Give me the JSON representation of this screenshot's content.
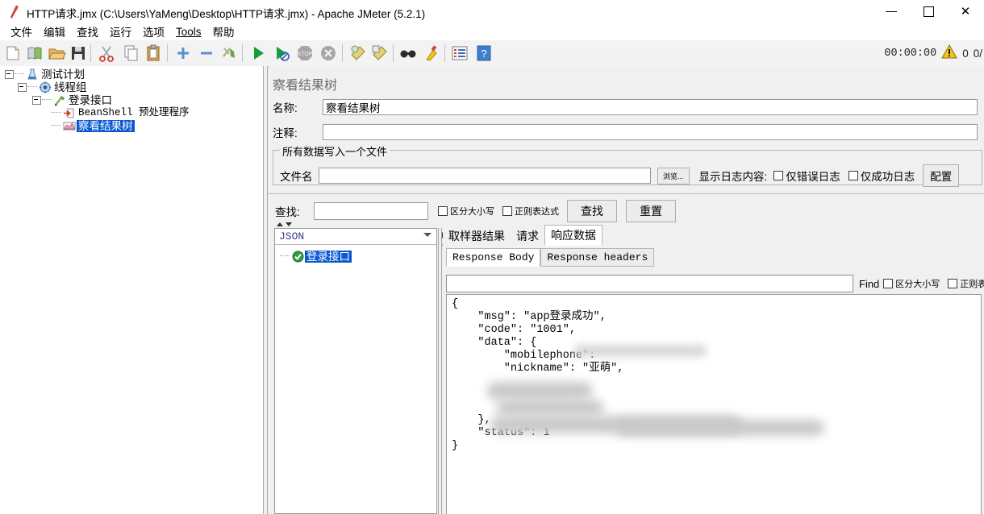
{
  "window": {
    "title": "HTTP请求.jmx (C:\\Users\\YaMeng\\Desktop\\HTTP请求.jmx) - Apache JMeter (5.2.1)",
    "app_icon": "jmeter-feather-icon",
    "minimize": "—",
    "maximize": "☐",
    "close": "✕"
  },
  "menubar": {
    "items": [
      {
        "label": "文件",
        "name": "menu-file"
      },
      {
        "label": "编辑",
        "name": "menu-edit"
      },
      {
        "label": "查找",
        "name": "menu-search"
      },
      {
        "label": "运行",
        "name": "menu-run"
      },
      {
        "label": "选项",
        "name": "menu-options"
      },
      {
        "label": "Tools",
        "name": "menu-tools"
      },
      {
        "label": "帮助",
        "name": "menu-help"
      }
    ]
  },
  "toolbar": {
    "buttons": [
      {
        "name": "new-icon",
        "title": "新建"
      },
      {
        "name": "templates-icon",
        "title": "模板"
      },
      {
        "name": "open-icon",
        "title": "打开"
      },
      {
        "name": "save-icon",
        "title": "保存"
      },
      {
        "name": "cut-icon",
        "title": "剪切"
      },
      {
        "name": "copy-icon",
        "title": "复制"
      },
      {
        "name": "paste-icon",
        "title": "粘贴"
      },
      {
        "name": "expand-icon",
        "title": "展开"
      },
      {
        "name": "collapse-icon",
        "title": "收起"
      },
      {
        "name": "toggle-icon",
        "title": "切换"
      },
      {
        "name": "start-icon",
        "title": "启动"
      },
      {
        "name": "start-no-pause-icon",
        "title": "无间隔启动"
      },
      {
        "name": "stop-icon",
        "title": "停止"
      },
      {
        "name": "shutdown-icon",
        "title": "关闭"
      },
      {
        "name": "clear-icon",
        "title": "清除"
      },
      {
        "name": "clear-all-icon",
        "title": "清除全部"
      },
      {
        "name": "search-icon",
        "title": "搜索"
      },
      {
        "name": "reset-search-icon",
        "title": "重置搜索"
      },
      {
        "name": "function-helper-icon",
        "title": "函数助手"
      },
      {
        "name": "help-icon",
        "title": "帮助"
      }
    ],
    "clock": "00:00:00",
    "warning_icon": "warning-triangle-icon",
    "warning_count": "0",
    "thread_count": "0/"
  },
  "tree": {
    "nodes": [
      {
        "label": "测试计划",
        "icon": "test-plan-icon",
        "depth": 0,
        "selected": false,
        "mono": false
      },
      {
        "label": "线程组",
        "icon": "thread-group-icon",
        "depth": 1,
        "selected": false,
        "mono": false
      },
      {
        "label": "登录接口",
        "icon": "http-sampler-icon",
        "depth": 2,
        "selected": false,
        "mono": false
      },
      {
        "label": "BeanShell 预处理程序",
        "icon": "preprocessor-icon",
        "depth": 3,
        "selected": false,
        "mono": true
      },
      {
        "label": "察看结果树",
        "icon": "view-results-tree-icon",
        "depth": 3,
        "selected": true,
        "mono": false
      }
    ]
  },
  "panel": {
    "title": "察看结果树",
    "name_label": "名称:",
    "name_value": "察看结果树",
    "comment_label": "注释:",
    "comment_value": "",
    "filegroup": {
      "title": "所有数据写入一个文件",
      "filename_label": "文件名",
      "filename_value": "",
      "browse_button": "浏览...",
      "log_display_label": "显示日志内容:",
      "errors_only_label": "仅错误日志",
      "success_only_label": "仅成功日志",
      "config_button": "配置"
    },
    "search": {
      "label": "查找:",
      "value": "",
      "case_sensitive_label": "区分大小写",
      "regex_label": "正则表达式",
      "find_button": "查找",
      "reset_button": "重置"
    }
  },
  "results": {
    "renderer": "JSON",
    "tree_items": [
      {
        "label": "登录接口",
        "status": "success",
        "status_icon": "green-check-icon"
      }
    ],
    "tabs": [
      {
        "label": "取样器结果",
        "active": false
      },
      {
        "label": "请求",
        "active": false
      },
      {
        "label": "响应数据",
        "active": true
      }
    ],
    "subtabs": [
      {
        "label": "Response Body",
        "active": true
      },
      {
        "label": "Response headers",
        "active": false
      }
    ],
    "find": {
      "value": "",
      "find_label": "Find",
      "case_sensitive_label": "区分大小写",
      "regex_label": "正则表达式"
    },
    "response_body": "{\n    \"msg\": \"app登录成功\",\n    \"code\": \"1001\",\n    \"data\": {\n        \"mobilephone\": \n        \"nickname\": \"亚萌\",\n\n\n\n    },\n    \"status\": 1\n}"
  },
  "colors": {
    "selection_blue": "#0a58d0",
    "panel_bg": "#f0f0f0",
    "field_bg": "#ffffff",
    "title_gray": "#6c6c6c",
    "success_green": "#2e9e3f",
    "warning_yellow": "#f2c41d"
  }
}
